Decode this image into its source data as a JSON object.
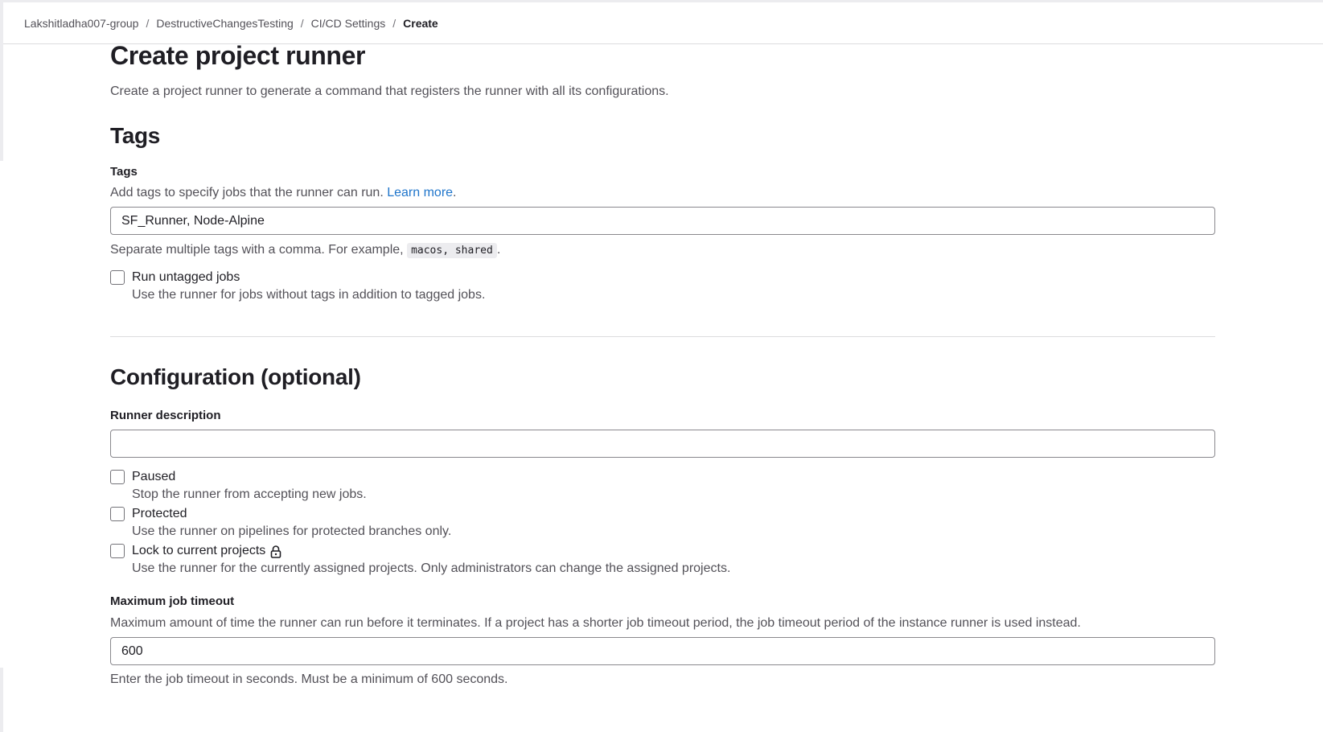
{
  "breadcrumb": {
    "items": [
      "Lakshitladha007-group",
      "DestructiveChangesTesting",
      "CI/CD Settings"
    ],
    "current": "Create",
    "separator": "/"
  },
  "page": {
    "title": "Create project runner",
    "description": "Create a project runner to generate a command that registers the runner with all its configurations."
  },
  "tags_section": {
    "heading": "Tags",
    "label": "Tags",
    "help": "Add tags to specify jobs that the runner can run.",
    "learn_more": "Learn more",
    "help_end": ".",
    "value": "SF_Runner, Node-Alpine",
    "hint_before": "Separate multiple tags with a comma. For example,",
    "hint_code": "macos, shared",
    "hint_after": ".",
    "run_untagged": {
      "label": "Run untagged jobs",
      "help": "Use the runner for jobs without tags in addition to tagged jobs.",
      "checked": false
    }
  },
  "config_section": {
    "heading": "Configuration (optional)",
    "description_label": "Runner description",
    "description_value": "",
    "paused": {
      "label": "Paused",
      "help": "Stop the runner from accepting new jobs.",
      "checked": false
    },
    "protected": {
      "label": "Protected",
      "help": "Use the runner on pipelines for protected branches only.",
      "checked": false
    },
    "lock": {
      "label": "Lock to current projects",
      "help": "Use the runner for the currently assigned projects. Only administrators can change the assigned projects.",
      "checked": false,
      "icon": "lock-icon"
    },
    "timeout_label": "Maximum job timeout",
    "timeout_help": "Maximum amount of time the runner can run before it terminates. If a project has a shorter job timeout period, the job timeout period of the instance runner is used instead.",
    "timeout_value": "600",
    "timeout_hint": "Enter the job timeout in seconds. Must be a minimum of 600 seconds."
  },
  "colors": {
    "link": "#1f75cb",
    "text": "#1f1e24",
    "muted": "#535158",
    "border": "#89888d"
  }
}
